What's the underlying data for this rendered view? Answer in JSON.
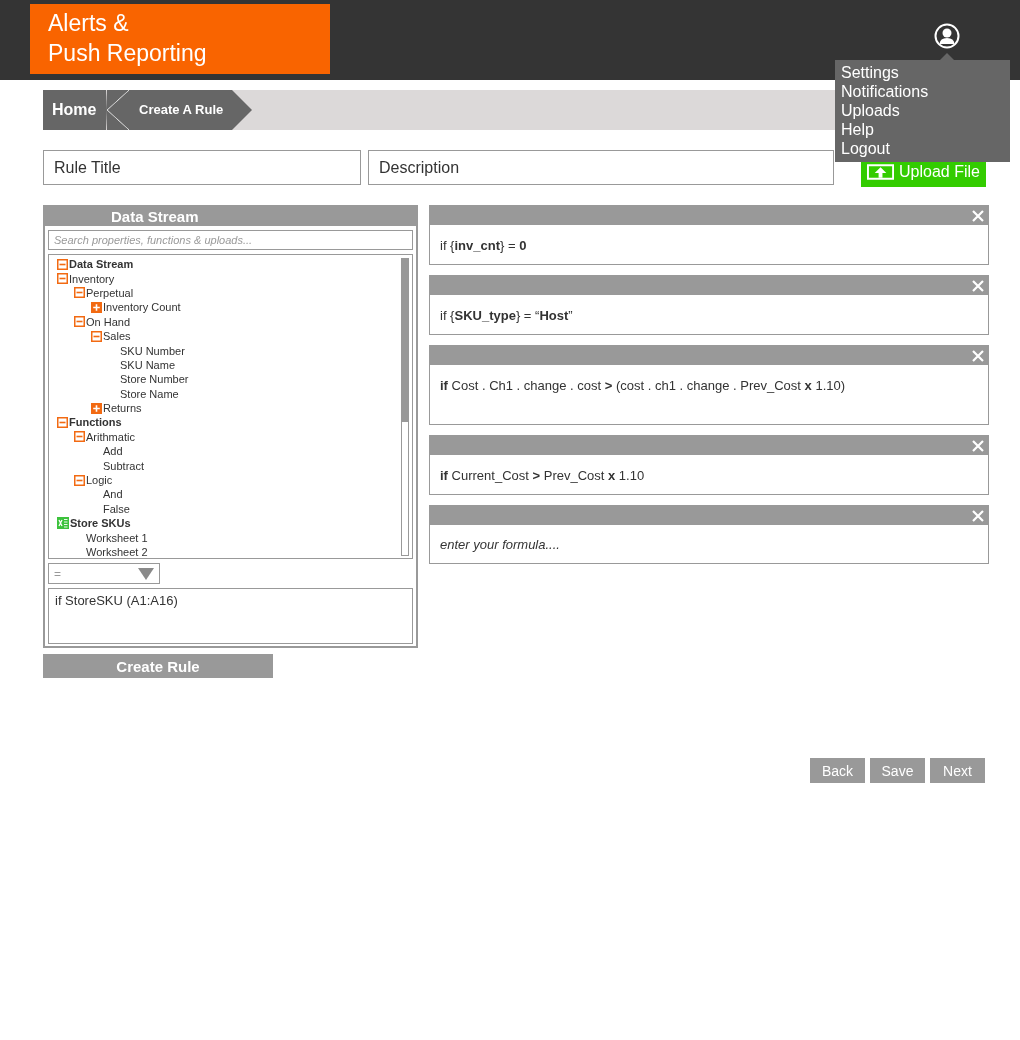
{
  "header": {
    "logo_lines": [
      "Alerts &",
      "Push Reporting"
    ]
  },
  "user_menu": {
    "items": [
      "Settings",
      "Notifications",
      "Uploads",
      "Help",
      "Logout"
    ]
  },
  "breadcrumb": [
    {
      "label": "Home",
      "selected": false
    },
    {
      "label": "Create A Rule",
      "selected": true
    }
  ],
  "rule_title": {
    "placeholder": "Rule Title"
  },
  "description": {
    "placeholder": "Description"
  },
  "upload_button": "Upload File",
  "data_stream": {
    "title": "Data Stream",
    "search": {
      "placeholder": "Search properties, functions & uploads..."
    },
    "tree": [
      {
        "label": "Data Stream",
        "kind": "group",
        "expanded": true,
        "bold": true
      },
      {
        "label": "Inventory",
        "kind": "group",
        "expanded": true,
        "bold": false,
        "children": [
          {
            "label": "Perpetual",
            "kind": "group",
            "expanded": true,
            "children": [
              {
                "label": "Inventory Count",
                "kind": "group",
                "expanded": false
              }
            ]
          },
          {
            "label": "On Hand",
            "kind": "group",
            "expanded": true,
            "children": [
              {
                "label": "Sales",
                "kind": "group",
                "expanded": true,
                "children": [
                  {
                    "label": "SKU Number",
                    "kind": "leaf"
                  },
                  {
                    "label": "SKU Name",
                    "kind": "leaf"
                  },
                  {
                    "label": "Store Number",
                    "kind": "leaf"
                  },
                  {
                    "label": "Store Name",
                    "kind": "leaf"
                  }
                ]
              },
              {
                "label": "Returns",
                "kind": "group",
                "expanded": false
              }
            ]
          }
        ]
      },
      {
        "label": "Functions",
        "kind": "group",
        "expanded": true,
        "bold": true,
        "children": [
          {
            "label": "Arithmatic",
            "kind": "group",
            "expanded": true,
            "children": [
              {
                "label": "Add",
                "kind": "leaf"
              },
              {
                "label": "Subtract",
                "kind": "leaf"
              }
            ]
          },
          {
            "label": "Logic",
            "kind": "group",
            "expanded": true,
            "children": [
              {
                "label": "And",
                "kind": "leaf"
              },
              {
                "label": "False",
                "kind": "leaf"
              }
            ]
          }
        ]
      },
      {
        "label": "Store SKUs",
        "kind": "spreadsheet",
        "bold": true,
        "children": [
          {
            "label": "Worksheet 1",
            "kind": "leaf"
          },
          {
            "label": "Worksheet 2",
            "kind": "leaf"
          }
        ]
      }
    ],
    "operator": "=",
    "expression": "if StoreSKU (A1:A16)"
  },
  "create_button": "Create Rule",
  "formulas": [
    {
      "kind": "formula",
      "text": "if {**inv_cnt**} = **0**"
    },
    {
      "kind": "formula",
      "text": "if {**SKU_type**} = “**Host**”"
    },
    {
      "kind": "formula",
      "text": "**if** Cost . Ch1 . change . cost **>** (cost . ch1 . change . Prev_Cost **x** 1.10)"
    },
    {
      "kind": "formula",
      "text": "**if** Current_Cost **>** Prev_Cost **x** 1.10"
    },
    {
      "kind": "empty",
      "placeholder": "enter your formula...."
    }
  ],
  "nav_buttons": [
    "Back",
    "Save",
    "Next"
  ]
}
